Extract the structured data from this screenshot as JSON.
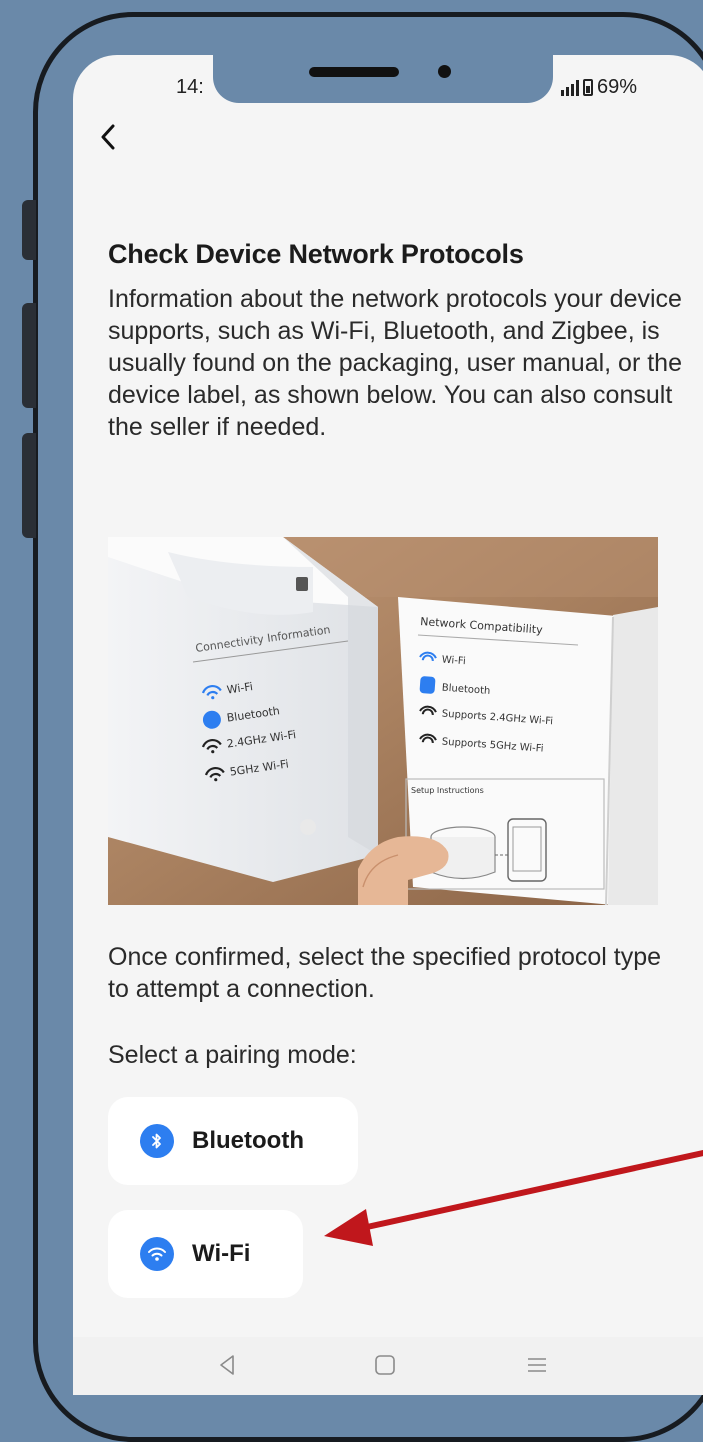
{
  "status_bar": {
    "time": "14:",
    "battery": "69%"
  },
  "header": {
    "title": "Check Device Network Protocols"
  },
  "intro": "Information about the network protocols your device supports, such as Wi-Fi, Bluetooth, and Zigbee, is usually found on the packaging, user manual, or the device label, as shown below. You can also consult the seller if needed.",
  "illustration": {
    "box_heading": "Connectivity Information",
    "box_items": [
      "Wi-Fi",
      "Bluetooth",
      "2.4GHz Wi-Fi",
      "5GHz Wi-Fi"
    ],
    "manual_heading": "Network Compatibility",
    "manual_items": [
      "Wi-Fi",
      "Bluetooth",
      "Supports 2.4GHz Wi-Fi",
      "Supports 5GHz Wi-Fi"
    ],
    "manual_setup": "Setup Instructions"
  },
  "confirm_text": "Once confirmed, select the specified protocol type to attempt a connection.",
  "pairing": {
    "label": "Select a pairing mode:",
    "options": [
      {
        "label": "Bluetooth",
        "icon": "bluetooth-icon"
      },
      {
        "label": "Wi-Fi",
        "icon": "wifi-icon"
      }
    ]
  },
  "colors": {
    "accent_blue": "#2d7ef0",
    "frame": "#6a89a9",
    "arrow": "#c0171c"
  }
}
